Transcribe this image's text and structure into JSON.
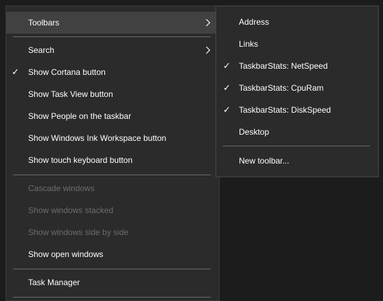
{
  "main_menu": {
    "toolbars": {
      "label": "Toolbars",
      "icon": "chevron-right-icon"
    },
    "search": {
      "label": "Search",
      "icon": "chevron-right-icon"
    },
    "show_cortana": {
      "label": "Show Cortana button",
      "checked": true
    },
    "show_task_view": {
      "label": "Show Task View button"
    },
    "show_people": {
      "label": "Show People on the taskbar"
    },
    "show_ink_workspace": {
      "label": "Show Windows Ink Workspace button"
    },
    "show_touch_keyboard": {
      "label": "Show touch keyboard button"
    },
    "cascade_windows": {
      "label": "Cascade windows",
      "disabled": true
    },
    "show_stacked": {
      "label": "Show windows stacked",
      "disabled": true
    },
    "show_side_by_side": {
      "label": "Show windows side by side",
      "disabled": true
    },
    "show_open_windows": {
      "label": "Show open windows"
    },
    "task_manager": {
      "label": "Task Manager"
    }
  },
  "toolbars_submenu": {
    "address": {
      "label": "Address"
    },
    "links": {
      "label": "Links"
    },
    "netspeed": {
      "label": "TaskbarStats: NetSpeed",
      "checked": true
    },
    "cpuram": {
      "label": "TaskbarStats: CpuRam",
      "checked": true
    },
    "diskspeed": {
      "label": "TaskbarStats: DiskSpeed",
      "checked": true
    },
    "desktop": {
      "label": "Desktop"
    },
    "new_toolbar": {
      "label": "New toolbar..."
    }
  },
  "glyphs": {
    "check": "✓"
  },
  "colors": {
    "menu_background": "#2b2b2b",
    "highlight": "#414141",
    "text": "#ffffff",
    "disabled_text": "#6d6d6d",
    "separator": "#6a6a6a"
  }
}
